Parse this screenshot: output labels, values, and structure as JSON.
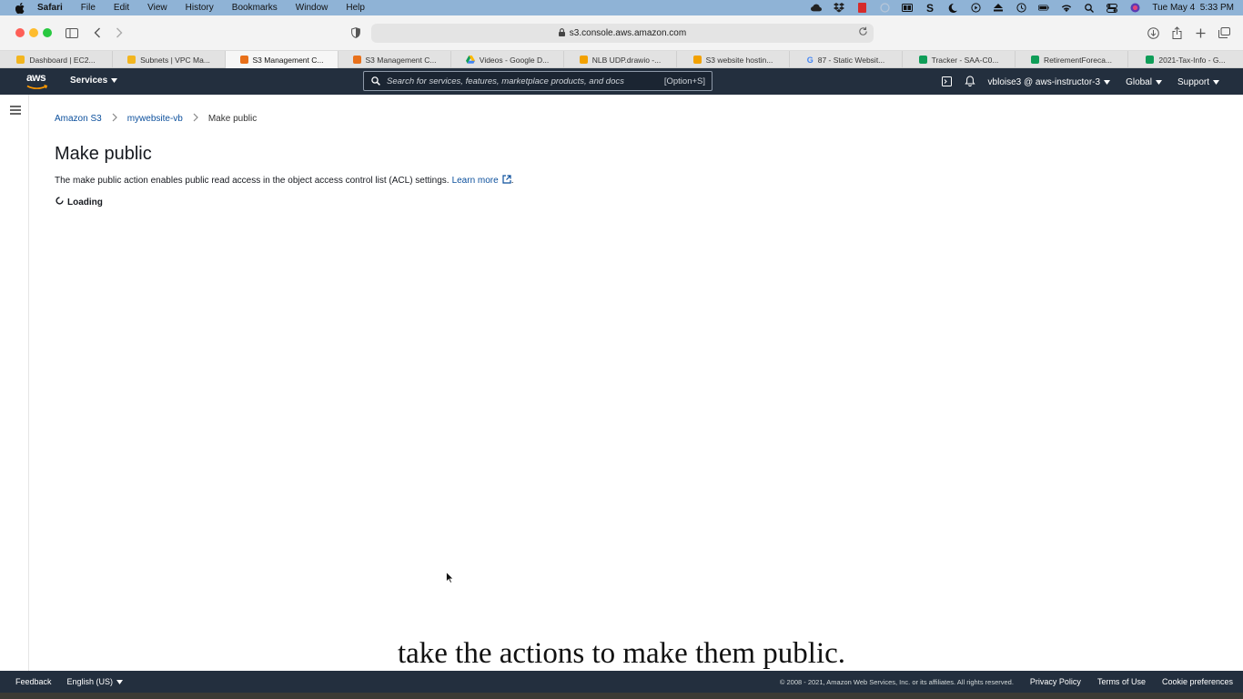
{
  "mac_menubar": {
    "app": "Safari",
    "menus": [
      "File",
      "Edit",
      "View",
      "History",
      "Bookmarks",
      "Window",
      "Help"
    ],
    "datetime": "Tue May 4  5:33 PM"
  },
  "browser": {
    "url": "s3.console.aws.amazon.com",
    "tabs": [
      {
        "label": "Dashboard | EC2...",
        "color": "#f2b51f",
        "active": false
      },
      {
        "label": "Subnets | VPC Ma...",
        "color": "#f2b51f",
        "active": false
      },
      {
        "label": "S3 Management C...",
        "color": "#e8701a",
        "active": true
      },
      {
        "label": "S3 Management C...",
        "color": "#e8701a",
        "active": false
      },
      {
        "label": "Videos - Google D...",
        "color": "#1fa463",
        "active": false
      },
      {
        "label": "NLB UDP.drawio -...",
        "color": "#f2a100",
        "active": false
      },
      {
        "label": "S3 website hostin...",
        "color": "#f2a100",
        "active": false
      },
      {
        "label": "87 - Static Websit...",
        "color": "#4285f4",
        "active": false
      },
      {
        "label": "Tracker - SAA-C0...",
        "color": "#0f9d58",
        "active": false
      },
      {
        "label": "RetirementForeca...",
        "color": "#0f9d58",
        "active": false
      },
      {
        "label": "2021-Tax-Info - G...",
        "color": "#0f9d58",
        "active": false
      }
    ]
  },
  "aws_nav": {
    "logo": "aws",
    "services": "Services",
    "search_placeholder": "Search for services, features, marketplace products, and docs",
    "search_shortcut": "[Option+S]",
    "account": "vbloise3 @ aws-instructor-3",
    "region": "Global",
    "support": "Support"
  },
  "breadcrumb": {
    "root": "Amazon S3",
    "bucket": "mywebsite-vb",
    "current": "Make public"
  },
  "page": {
    "title": "Make public",
    "description": "The make public action enables public read access in the object access control list (ACL) settings.",
    "learn_more": "Learn more",
    "loading": "Loading"
  },
  "caption": "take the actions to make them public.",
  "footer": {
    "feedback": "Feedback",
    "language": "English (US)",
    "copyright": "© 2008 - 2021, Amazon Web Services, Inc. or its affiliates. All rights reserved.",
    "privacy": "Privacy Policy",
    "terms": "Terms of Use",
    "cookies": "Cookie preferences"
  }
}
